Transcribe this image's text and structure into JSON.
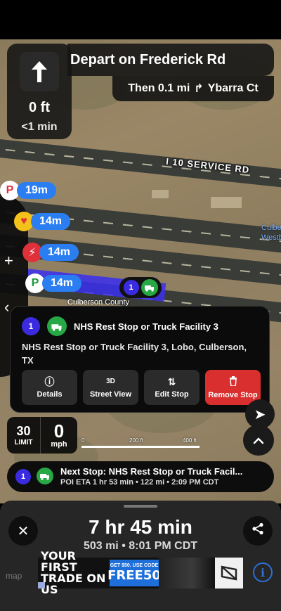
{
  "nav": {
    "distance": "0 ft",
    "time": "<1 min",
    "instruction": "Depart on Frederick Rd",
    "then_label": "Then 0.1 mi",
    "then_street": "Ybarra Ct"
  },
  "map": {
    "road_label": "I 10 SERVICE RD",
    "town_label": "Culberson County",
    "side_label_1": "Culbe",
    "side_label_2": "Westbo",
    "pois": [
      {
        "icon": "parking-icon",
        "glyph": "P",
        "distance": "19m",
        "color": "#e0303a"
      },
      {
        "icon": "love-travel-stop-icon",
        "glyph": "♥",
        "distance": "14m",
        "color": "#e0303a"
      },
      {
        "icon": "fuel-brand-icon",
        "glyph": "⚡",
        "distance": "14m",
        "color": "#e0303a"
      },
      {
        "icon": "pilot-icon",
        "glyph": "P",
        "distance": "14m",
        "color": "#1a9a3a"
      }
    ],
    "pin_number": "1",
    "scale": {
      "t0": "0",
      "t1": "200 ft",
      "t2": "400 ft"
    }
  },
  "popup": {
    "number": "1",
    "title": "NHS Rest Stop or Truck Facility 3",
    "address": "NHS Rest Stop or Truck Facility 3, Lobo, Culberson, TX",
    "actions": [
      {
        "label": "Details",
        "glyph": "ⓘ"
      },
      {
        "label": "Street View",
        "glyph": "3D"
      },
      {
        "label": "Edit Stop",
        "glyph": "⇅"
      },
      {
        "label": "Remove Stop",
        "glyph": "🗑"
      }
    ]
  },
  "speed": {
    "limit_value": "30",
    "limit_label": "LIMIT",
    "current_value": "0",
    "current_unit": "mph"
  },
  "next_stop": {
    "number": "1",
    "title": "Next Stop: NHS Rest Stop or Truck Facil...",
    "subtitle": "POI ETA 1 hr 53 min • 122 mi • 2:09 PM CDT"
  },
  "trip": {
    "duration": "7 hr 45 min",
    "summary": "503 mi • 8:01 PM CDT"
  },
  "ad": {
    "headline": "YOUR FIRST TRADE ON US",
    "promo_small": "GET $50. USE CODE",
    "promo_code": "FREE50"
  },
  "watermark": "map",
  "colors": {
    "accent_blue": "#2a7ef2",
    "route_blue": "#3a2ff0",
    "stop_purple": "#3b2be0",
    "truck_green": "#27a844",
    "danger_red": "#d92f2f"
  }
}
